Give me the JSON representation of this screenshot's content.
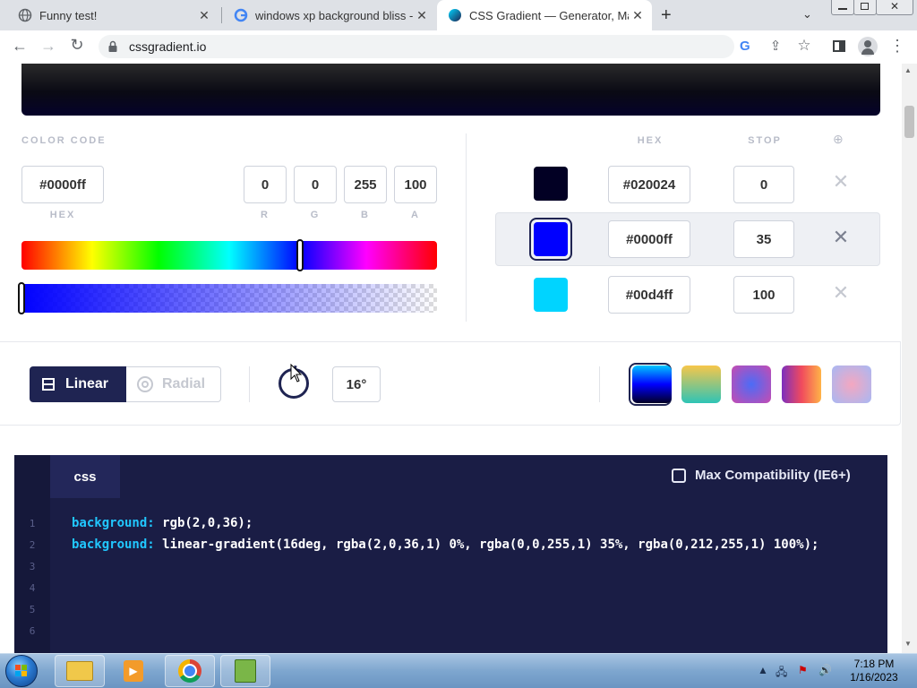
{
  "browser": {
    "tabs": [
      {
        "title": "Funny test!",
        "active": false
      },
      {
        "title": "windows xp background bliss - G",
        "active": false
      },
      {
        "title": "CSS Gradient — Generator, Make",
        "active": true
      }
    ],
    "new_tab": "+",
    "url": "cssgradient.io"
  },
  "color_code": {
    "label": "COLOR CODE",
    "hex_value": "#0000ff",
    "hex_label": "HEX",
    "r": "0",
    "g": "0",
    "b": "255",
    "a": "100",
    "r_label": "R",
    "g_label": "G",
    "b_label": "B",
    "a_label": "A",
    "hue_position": 0.67,
    "alpha_position": 0.0
  },
  "stops": {
    "hex_header": "HEX",
    "stop_header": "STOP",
    "add_icon": "⊕",
    "rows": [
      {
        "color": "#020024",
        "hex": "#020024",
        "stop": "0"
      },
      {
        "color": "#0000ff",
        "hex": "#0000ff",
        "stop": "35"
      },
      {
        "color": "#00d4ff",
        "hex": "#00d4ff",
        "stop": "100"
      }
    ]
  },
  "mode": {
    "linear_label": "Linear",
    "radial_label": "Radial",
    "angle": "16°"
  },
  "presets": [
    "linear-gradient(180deg,#00c6ff,#0000ff,#020024)",
    "linear-gradient(180deg,#f7c64a,#2ec4b6)",
    "radial-gradient(circle,#4b6cf7,#c84bb0)",
    "linear-gradient(90deg,#7b2fbe,#f04a5e,#ffb347)",
    "radial-gradient(circle,#f4a7c0,#a7b8f4)"
  ],
  "code": {
    "tab_label": "css",
    "max_compat_label": "Max Compatibility (IE6+)",
    "line_numbers": [
      "1",
      "2",
      "3",
      "4",
      "5",
      "6"
    ],
    "line1_prop": "background:",
    "line1_val": " rgb(2,0,36);",
    "line2_prop": "background:",
    "line2_val": " linear-gradient(16deg, rgba(2,0,36,1) 0%, rgba(0,0,255,1) 35%, rgba(0,212,255,1) 100%);"
  },
  "taskbar": {
    "time": "7:18 PM",
    "date": "1/16/2023"
  }
}
